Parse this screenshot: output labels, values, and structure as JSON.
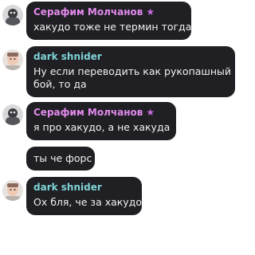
{
  "colors": {
    "bubble_bg": "#1f1f24",
    "name_serafim": "#e38aec",
    "name_dark": "#7fd3d6",
    "star": "#c56bdc"
  },
  "messages": [
    {
      "sender": "Серафим Молчанов",
      "badge_icon": "star-icon",
      "text": "хакудо тоже не термин тогда"
    },
    {
      "sender": "dark shnider",
      "text_line1": "Ну если переводить как рукопашный",
      "text_line2": "бой, то да"
    },
    {
      "sender": "Серафим Молчанов",
      "badge_icon": "star-icon",
      "text": "я про хакудо, а не хакуда"
    },
    {
      "text": "ты че форс"
    },
    {
      "sender": "dark shnider",
      "text": "Ох бля, че за хакудо"
    }
  ]
}
